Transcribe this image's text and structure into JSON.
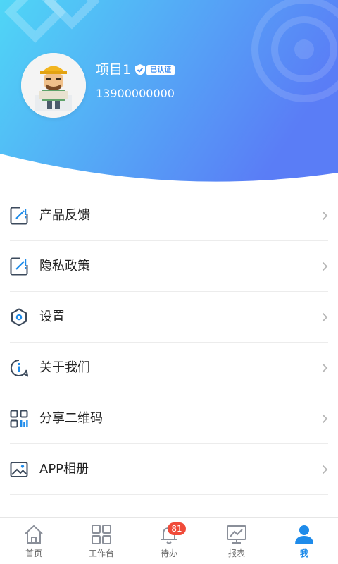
{
  "profile": {
    "name": "项目1",
    "verified_label": "已认证",
    "phone": "13900000000",
    "avatar_icon": "worker-avatar-icon"
  },
  "colors": {
    "header_gradient_start": "#4fd3f5",
    "header_gradient_end": "#5b7cf6",
    "accent": "#1e8bea",
    "badge": "#f04b3a"
  },
  "menu": {
    "items": [
      {
        "label": "产品反馈",
        "icon": "feedback-icon"
      },
      {
        "label": "隐私政策",
        "icon": "privacy-icon"
      },
      {
        "label": "设置",
        "icon": "settings-icon"
      },
      {
        "label": "关于我们",
        "icon": "info-icon"
      },
      {
        "label": "分享二维码",
        "icon": "qrcode-icon"
      },
      {
        "label": "APP相册",
        "icon": "album-icon"
      }
    ]
  },
  "tabbar": {
    "tabs": [
      {
        "label": "首页",
        "icon": "home-icon"
      },
      {
        "label": "工作台",
        "icon": "workbench-icon"
      },
      {
        "label": "待办",
        "icon": "bell-icon",
        "badge": "81"
      },
      {
        "label": "报表",
        "icon": "report-icon"
      },
      {
        "label": "我",
        "icon": "user-icon",
        "active": true
      }
    ]
  }
}
